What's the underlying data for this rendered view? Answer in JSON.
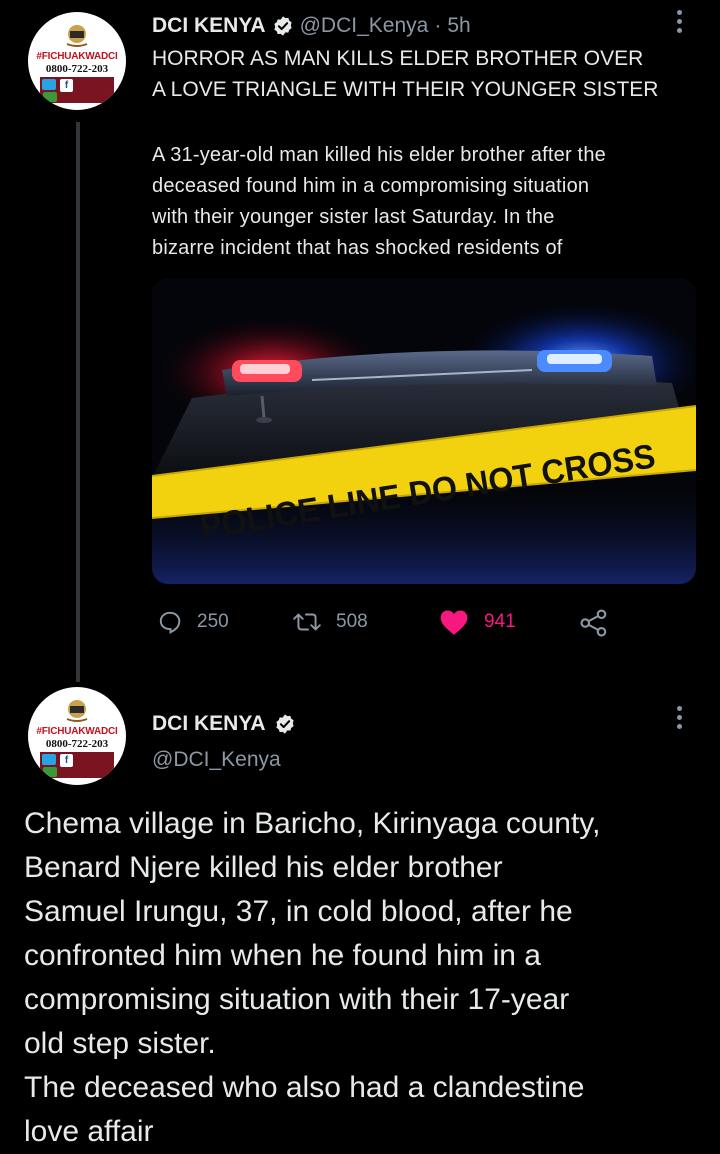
{
  "tweet1": {
    "name": "DCI KENYA",
    "handle": "@DCI_Kenya",
    "separator": "·",
    "time": "5h",
    "headline_1": "HORROR AS MAN KILLS ELDER BROTHER OVER",
    "headline_2": "A LOVE TRIANGLE WITH THEIR YOUNGER SISTER",
    "body_lines": [
      "A 31-year-old man killed his elder brother after the",
      "deceased found him in a compromising situation",
      "with their younger sister last Saturday. In the",
      "bizarre incident that has shocked residents of"
    ],
    "image_caption": "POLICE LINE DO NOT CROSS",
    "replies": "250",
    "retweets": "508",
    "likes": "941"
  },
  "tweet2": {
    "name": "DCI KENYA",
    "handle": "@DCI_Kenya",
    "body_lines": [
      "Chema village in Baricho, Kirinyaga county,",
      "Benard Njere killed his elder brother",
      "Samuel Irungu, 37, in cold blood, after he",
      "confronted him when he found him in a",
      "compromising situation with their 17-year",
      "old step sister.",
      "The deceased who also had a clandestine",
      "love affair"
    ]
  },
  "avatar": {
    "tag": "#FICHUAKWADCI",
    "phone": "0800-722-203"
  },
  "icons": {
    "verified": "verified-badge-icon",
    "more": "more-options-icon",
    "reply": "reply-icon",
    "retweet": "retweet-icon",
    "like": "heart-icon",
    "share": "share-icon"
  },
  "colors": {
    "background": "#000000",
    "text": "#e7e9ea",
    "muted": "#8b98a5",
    "like": "#f91880",
    "tape": "#f2d20f"
  }
}
